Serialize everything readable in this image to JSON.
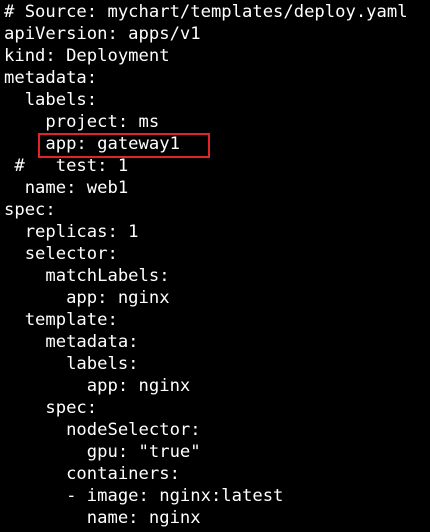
{
  "terminal": {
    "lines": [
      "# Source: mychart/templates/deploy.yaml",
      "apiVersion: apps/v1",
      "kind: Deployment",
      "metadata:",
      "  labels:",
      "    project: ms",
      "    app: gateway1",
      " #   test: 1",
      "  name: web1",
      "spec:",
      "  replicas: 1",
      "  selector:",
      "    matchLabels:",
      "      app: nginx",
      "  template:",
      "    metadata:",
      "      labels:",
      "        app: nginx",
      "    spec:",
      "      nodeSelector:",
      "        gpu: \"true\"",
      "      containers:",
      "      - image: nginx:latest",
      "        name: nginx"
    ]
  },
  "colors": {
    "background": "#000000",
    "text": "#ffffff",
    "highlight_border": "#e0242a"
  }
}
